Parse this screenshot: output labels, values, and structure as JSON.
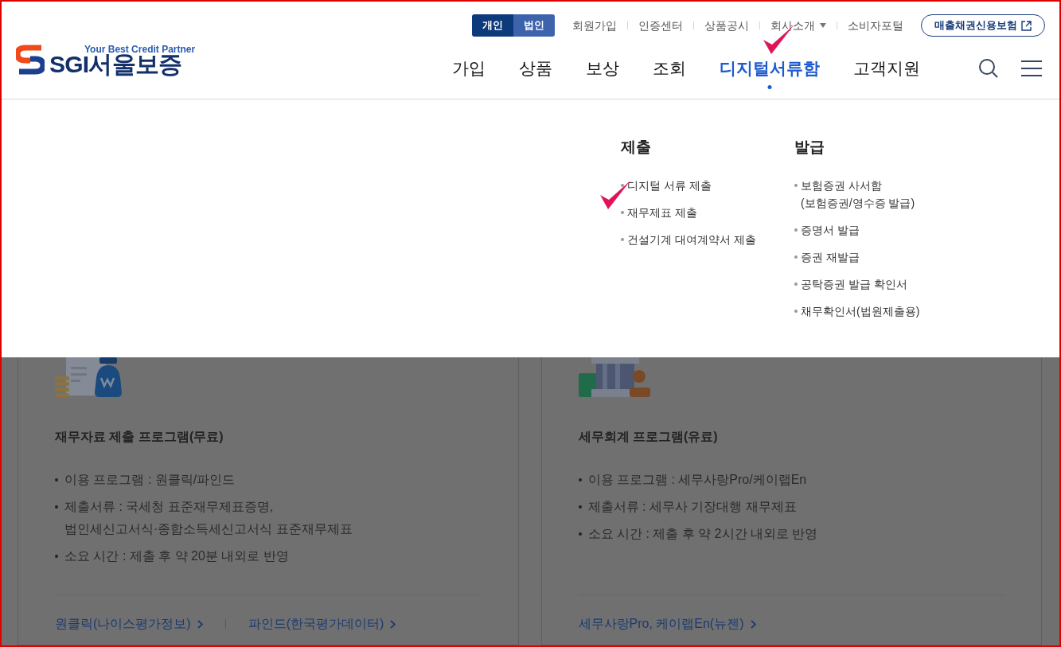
{
  "header": {
    "logo": {
      "tagline": "Your Best Credit Partner",
      "name": "SGI서울보증"
    },
    "segment": [
      {
        "label": "개인",
        "selected": true
      },
      {
        "label": "법인",
        "selected": false
      }
    ],
    "utility_links": [
      {
        "label": "회원가입",
        "kind": "link"
      },
      {
        "label": "인증센터",
        "kind": "link"
      },
      {
        "label": "상품공시",
        "kind": "link"
      },
      {
        "label": "회사소개",
        "kind": "dropdown"
      },
      {
        "label": "소비자포털",
        "kind": "link"
      }
    ],
    "external_button": "매출채권신용보험",
    "nav": [
      {
        "label": "가입",
        "selected": false
      },
      {
        "label": "상품",
        "selected": false
      },
      {
        "label": "보상",
        "selected": false
      },
      {
        "label": "조회",
        "selected": false
      },
      {
        "label": "디지털서류함",
        "selected": true
      },
      {
        "label": "고객지원",
        "selected": false
      }
    ]
  },
  "mega_menu": {
    "columns": [
      {
        "title": "제출",
        "items": [
          {
            "lines": [
              "디지털 서류 제출"
            ]
          },
          {
            "lines": [
              "재무제표 제출"
            ]
          },
          {
            "lines": [
              "건설기계 대여계약서 제출"
            ]
          }
        ]
      },
      {
        "title": "발급",
        "items": [
          {
            "lines": [
              "보험증권 사서함",
              "(보험증권/영수증 발급)"
            ]
          },
          {
            "lines": [
              "증명서 발급"
            ]
          },
          {
            "lines": [
              "증권 재발급"
            ]
          },
          {
            "lines": [
              "공탁증권 발급 확인서"
            ]
          },
          {
            "lines": [
              "채무확인서(법원제출용)"
            ]
          }
        ]
      }
    ]
  },
  "cards": [
    {
      "title": "재무자료 제출 프로그램(무료)",
      "bullets": [
        [
          "이용 프로그램 : 원클릭/파인드"
        ],
        [
          "제출서류 : 국세청 표준재무제표증명,",
          "법인세신고서식·종합소득세신고서식 표준재무제표"
        ],
        [
          "소요 시간 : 제출 후 약 20분 내외로 반영"
        ]
      ],
      "links": [
        "원클릭(나이스평가정보)",
        "파인드(한국평가데이터)"
      ]
    },
    {
      "title": "세무회계 프로그램(유료)",
      "bullets": [
        [
          "이용 프로그램 : 세무사랑Pro/케이랩En"
        ],
        [
          "제출서류 : 세무사 기장대행 재무제표"
        ],
        [
          "소요 시간 : 제출 후 약 2시간 내외로 반영"
        ]
      ],
      "links": [
        "세무사랑Pro, 케이랩En(뉴젠)"
      ]
    }
  ]
}
